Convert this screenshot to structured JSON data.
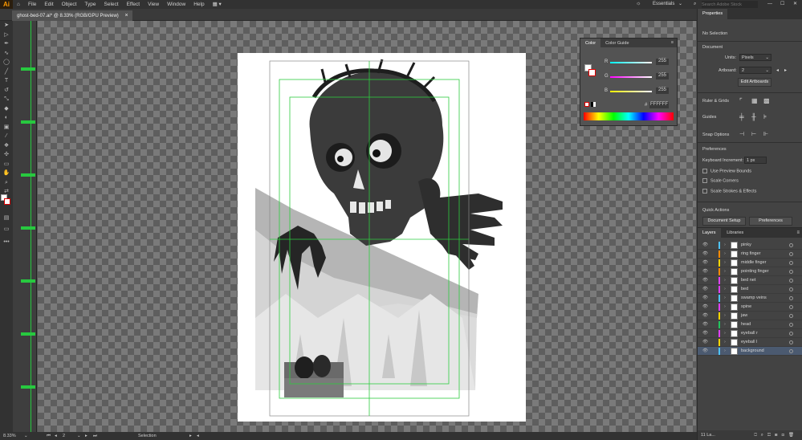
{
  "app": {
    "logo": "Ai"
  },
  "menu": [
    "File",
    "Edit",
    "Object",
    "Type",
    "Select",
    "Effect",
    "View",
    "Window",
    "Help"
  ],
  "workspace": "Essentials",
  "search": {
    "placeholder": "Search Adobe Stock"
  },
  "document_tab": {
    "title": "ghost-bed-07.ai* @ 8.33% (RGB/GPU Preview)",
    "close": "×"
  },
  "status": {
    "zoom": "8.33%",
    "page": "2",
    "tool": "Selection"
  },
  "color_panel": {
    "tabs": [
      "Color",
      "Color Guide"
    ],
    "r_label": "R",
    "g_label": "G",
    "b_label": "B",
    "r": "255",
    "g": "255",
    "b": "255",
    "hex_label": "#",
    "hex": "FFFFFF"
  },
  "properties": {
    "tab": "Properties",
    "selection": "No Selection",
    "document_label": "Document",
    "units_label": "Units:",
    "units_value": "Pixels",
    "artboard_label": "Artboard:",
    "artboard_value": "2",
    "edit_artboards": "Edit Artboards",
    "ruler_grids": "Ruler & Grids",
    "guides": "Guides",
    "snap_options": "Snap Options",
    "preferences_label": "Preferences",
    "keyboard_increment_label": "Keyboard Increment:",
    "keyboard_increment_value": "1 px",
    "use_preview_bounds": "Use Preview Bounds",
    "scale_corners": "Scale Corners",
    "scale_strokes": "Scale Strokes & Effects",
    "quick_actions": "Quick Actions",
    "document_setup": "Document Setup",
    "preferences_button": "Preferences"
  },
  "layers_panel": {
    "tabs": [
      "Layers",
      "Libraries"
    ],
    "footer": "11 La...",
    "layers": [
      {
        "name": "pinky",
        "color": "#4fc3f7"
      },
      {
        "name": "ring finger",
        "color": "#ff8a00"
      },
      {
        "name": "middle finger",
        "color": "#ffd600"
      },
      {
        "name": "pointing finger",
        "color": "#ff8a00"
      },
      {
        "name": "bed net",
        "color": "#e040fb"
      },
      {
        "name": "bed",
        "color": "#e040fb"
      },
      {
        "name": "swamp veins",
        "color": "#4fc3f7"
      },
      {
        "name": "spine",
        "color": "#e040fb"
      },
      {
        "name": "jaw",
        "color": "#ffd600"
      },
      {
        "name": "head",
        "color": "#22c55e"
      },
      {
        "name": "eyeball r",
        "color": "#e040fb"
      },
      {
        "name": "eyeball l",
        "color": "#ffd600"
      },
      {
        "name": "background",
        "color": "#4fc3f7"
      }
    ]
  }
}
